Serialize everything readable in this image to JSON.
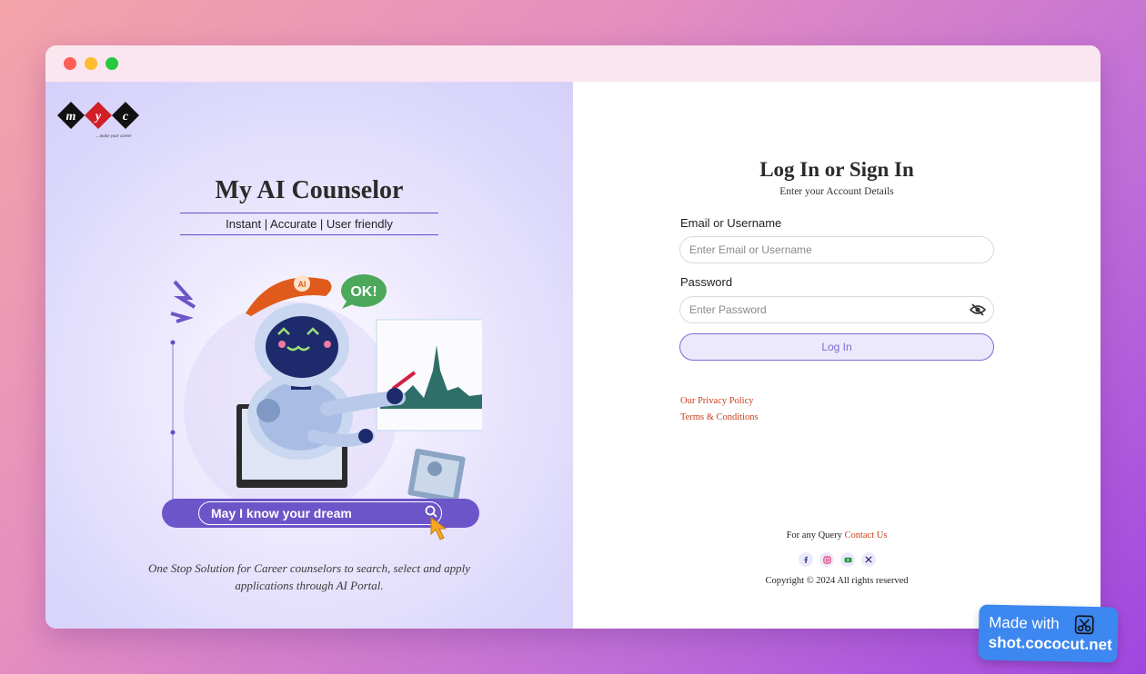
{
  "left": {
    "logo_letters": [
      "m",
      "y",
      "c"
    ],
    "logo_tagline": "...make your career",
    "title": "My AI Counselor",
    "subtitle": "Instant | Accurate | User friendly",
    "bubble_text": "OK!",
    "hat_badge": "AI",
    "search_text": "May I know your dream",
    "tagline": "One Stop Solution for Career counselors to search, select and apply applications through AI Portal."
  },
  "login": {
    "title": "Log In or Sign In",
    "subtitle": "Enter your Account Details",
    "email_label": "Email or Username",
    "email_placeholder": "Enter Email or Username",
    "email_value": "",
    "password_label": "Password",
    "password_placeholder": "Enter Password",
    "password_value": "",
    "button_label": "Log In",
    "privacy_link": "Our Privacy Policy",
    "terms_link": "Terms & Conditions"
  },
  "footer": {
    "query_text": "For any Query",
    "contact_link": "Contact Us",
    "socials": [
      "facebook-icon",
      "instagram-icon",
      "youtube-icon",
      "x-icon"
    ],
    "copyright": "Copyright © 2024 All rights reserved"
  },
  "badge": {
    "line1": "Made with",
    "line2": "shot.cococut.net"
  },
  "colors": {
    "accent": "#6b55c8",
    "link": "#c8401c",
    "button_bg": "#ece9fc"
  }
}
